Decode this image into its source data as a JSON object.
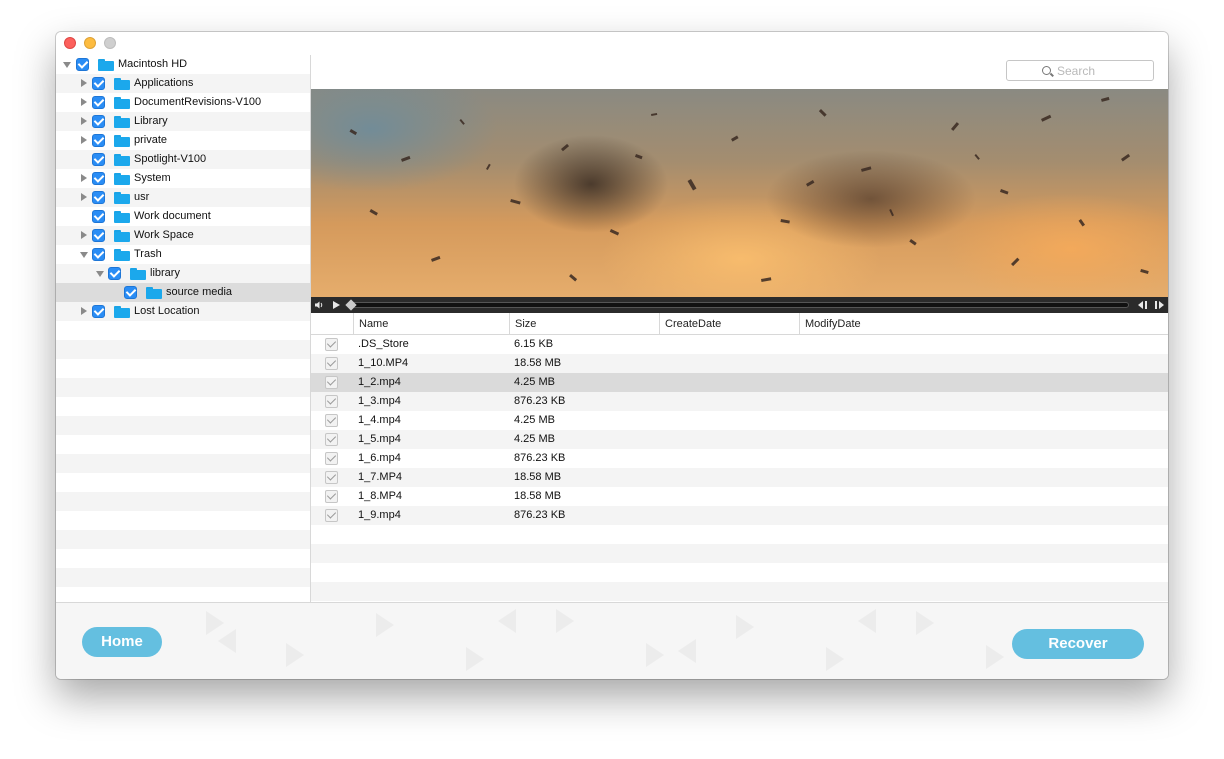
{
  "sidebar": {
    "tree": [
      {
        "label": "Macintosh HD",
        "disclosure": "open"
      },
      {
        "label": "Applications",
        "disclosure": "closed"
      },
      {
        "label": "DocumentRevisions-V100",
        "disclosure": "closed"
      },
      {
        "label": "Library",
        "disclosure": "closed"
      },
      {
        "label": "private",
        "disclosure": "closed"
      },
      {
        "label": "Spotlight-V100",
        "disclosure": "none"
      },
      {
        "label": "System",
        "disclosure": "closed"
      },
      {
        "label": "usr",
        "disclosure": "closed"
      },
      {
        "label": "Work document",
        "disclosure": "none"
      },
      {
        "label": "Work Space",
        "disclosure": "closed"
      },
      {
        "label": "Trash",
        "disclosure": "open"
      },
      {
        "label": "library",
        "disclosure": "open"
      },
      {
        "label": "source media",
        "disclosure": "none",
        "selected": true
      },
      {
        "label": "Lost Location",
        "disclosure": "closed"
      }
    ]
  },
  "search": {
    "placeholder": "Search"
  },
  "table": {
    "columns": [
      "Name",
      "Size",
      "CreateDate",
      "ModifyDate"
    ],
    "rows": [
      {
        "name": ".DS_Store",
        "size": "6.15 KB"
      },
      {
        "name": "1_10.MP4",
        "size": "18.58 MB"
      },
      {
        "name": "1_2.mp4",
        "size": "4.25 MB",
        "selected": true
      },
      {
        "name": "1_3.mp4",
        "size": "876.23 KB"
      },
      {
        "name": "1_4.mp4",
        "size": "4.25 MB"
      },
      {
        "name": "1_5.mp4",
        "size": "4.25 MB"
      },
      {
        "name": "1_6.mp4",
        "size": "876.23 KB"
      },
      {
        "name": "1_7.MP4",
        "size": "18.58 MB"
      },
      {
        "name": "1_8.MP4",
        "size": "18.58 MB"
      },
      {
        "name": "1_9.mp4",
        "size": "876.23 KB"
      }
    ]
  },
  "footer": {
    "home_label": "Home",
    "recover_label": "Recover"
  },
  "colors": {
    "accent": "#64bfe0",
    "checkbox": "#2a8df5",
    "folder": "#1ba8ec"
  }
}
